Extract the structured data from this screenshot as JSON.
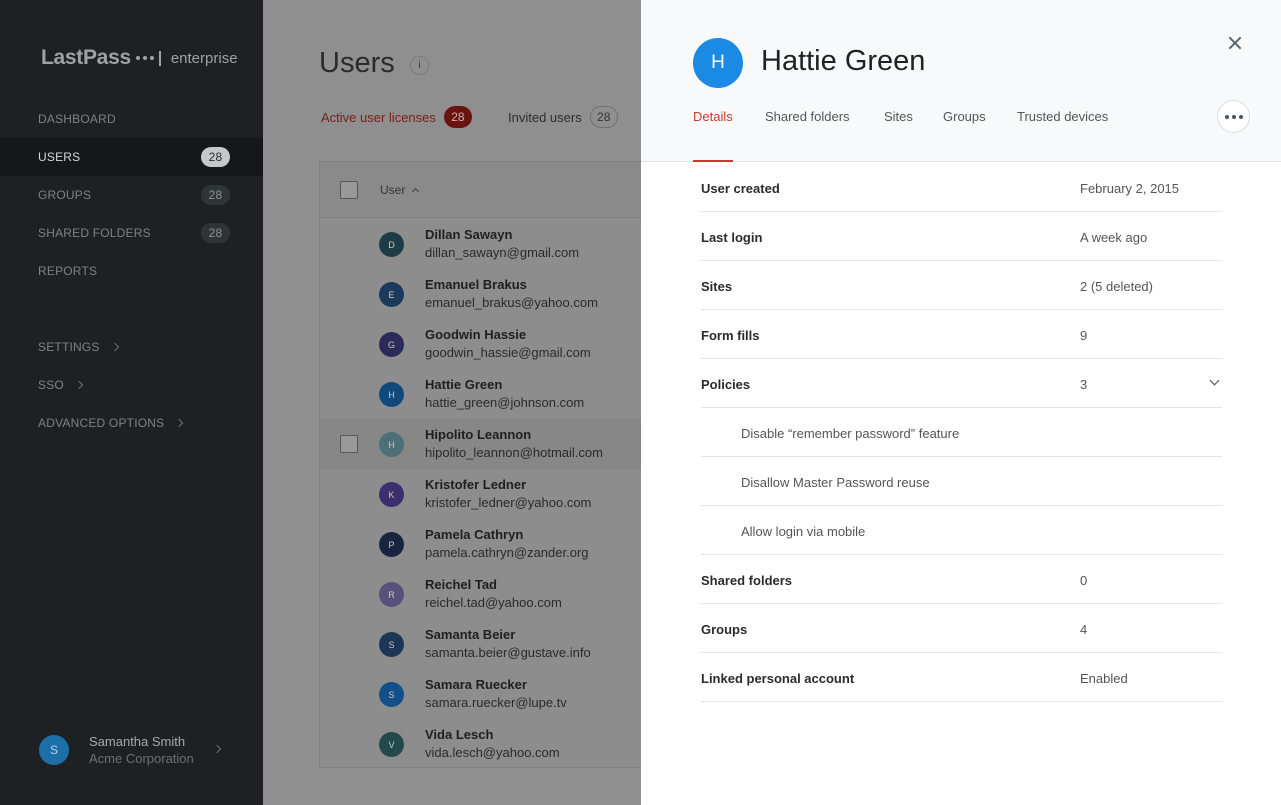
{
  "sidebar": {
    "logo": {
      "main": "LastPass",
      "sub": "enterprise"
    },
    "nav": [
      {
        "label": "DASHBOARD",
        "badge": null
      },
      {
        "label": "USERS",
        "badge": "28"
      },
      {
        "label": "GROUPS",
        "badge": "28"
      },
      {
        "label": "SHARED FOLDERS",
        "badge": "28"
      },
      {
        "label": "REPORTS",
        "badge": null
      },
      {
        "label": "SETTINGS",
        "badge": null
      },
      {
        "label": "SSO",
        "badge": null
      },
      {
        "label": "ADVANCED OPTIONS",
        "badge": null
      }
    ],
    "profile": {
      "initial": "S",
      "name": "Samantha Smith",
      "org": "Acme Corporation"
    }
  },
  "main": {
    "title": "Users",
    "info": "i",
    "tabs": [
      {
        "label": "Active user licenses",
        "count": "28"
      },
      {
        "label": "Invited users",
        "count": "28"
      }
    ],
    "table": {
      "header": "User",
      "rows": [
        {
          "initial": "D",
          "name": "Dillan Sawayn",
          "email": "dillan_sawayn@gmail.com",
          "color": "#1f3c46"
        },
        {
          "initial": "E",
          "name": "Emanuel Brakus",
          "email": "emanuel_brakus@yahoo.com",
          "color": "#1c3a5c"
        },
        {
          "initial": "G",
          "name": "Goodwin Hassie",
          "email": "goodwin_hassie@gmail.com",
          "color": "#2c2a58"
        },
        {
          "initial": "H",
          "name": "Hattie Green",
          "email": "hattie_green@johnson.com",
          "color": "#0f4a7a"
        },
        {
          "initial": "H",
          "name": "Hipolito Leannon",
          "email": "hipolito_leannon@hotmail.com",
          "color": "#4c6f78"
        },
        {
          "initial": "K",
          "name": "Kristofer Ledner",
          "email": "kristofer_ledner@yahoo.com",
          "color": "#3b2f6e"
        },
        {
          "initial": "P",
          "name": "Pamela Cathryn",
          "email": "pamela.cathryn@zander.org",
          "color": "#1a2440"
        },
        {
          "initial": "R",
          "name": "Reichel Tad",
          "email": "reichel.tad@yahoo.com",
          "color": "#58527a"
        },
        {
          "initial": "S",
          "name": "Samanta Beier",
          "email": "samanta.beier@gustave.info",
          "color": "#1e3556"
        },
        {
          "initial": "S",
          "name": "Samara Ruecker",
          "email": "samara.ruecker@lupe.tv",
          "color": "#13508a"
        },
        {
          "initial": "V",
          "name": "Vida Lesch",
          "email": "vida.lesch@yahoo.com",
          "color": "#234a4a"
        }
      ]
    }
  },
  "panel": {
    "initial": "H",
    "name": "Hattie Green",
    "tabs": [
      "Details",
      "Shared folders",
      "Sites",
      "Groups",
      "Trusted devices"
    ],
    "details": [
      {
        "label": "User created",
        "value": "February 2, 2015"
      },
      {
        "label": "Last login",
        "value": "A week ago"
      },
      {
        "label": "Sites",
        "value": "2 (5 deleted)"
      },
      {
        "label": "Form fills",
        "value": "9"
      },
      {
        "label": "Policies",
        "value": "3"
      }
    ],
    "policies": [
      "Disable “remember password” feature",
      "Disallow Master Password reuse",
      "Allow login via mobile"
    ],
    "details_after": [
      {
        "label": "Shared folders",
        "value": "0"
      },
      {
        "label": "Groups",
        "value": "4"
      },
      {
        "label": "Linked personal account",
        "value": "Enabled"
      }
    ]
  },
  "colors": {
    "accent": "#d0362e",
    "avatar_blue": "#1a8ae5",
    "sidebar_bg": "#1d2124"
  }
}
